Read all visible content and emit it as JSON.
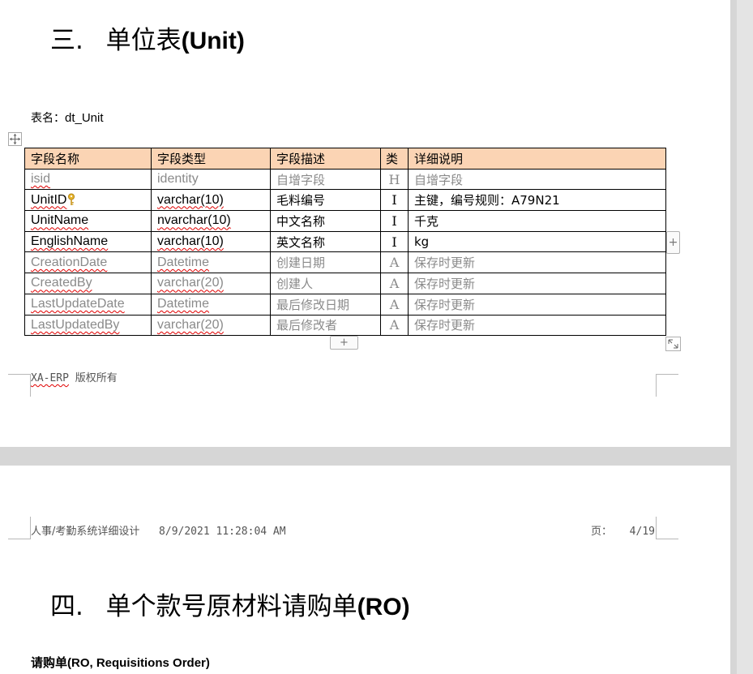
{
  "section3": {
    "number": "三.",
    "title_cn": "单位表",
    "title_en": "(Unit)",
    "table_name_label": "表名：",
    "table_name": "dt_Unit",
    "columns": [
      "字段名称",
      "字段类型",
      "字段描述",
      "类",
      "详细说明"
    ],
    "rows": [
      {
        "name": "isid",
        "type": "identity",
        "desc": "自增字段",
        "cat": "H",
        "detail": "自增字段",
        "muted": true
      },
      {
        "name": "UnitID",
        "type": "varchar(10)",
        "desc": "毛料编号",
        "cat": "I",
        "detail": "主键，编号规则：A79N21",
        "muted": false,
        "key": true
      },
      {
        "name": "UnitName",
        "type": "nvarchar(10)",
        "desc": "中文名称",
        "cat": "I",
        "detail": "千克",
        "muted": false
      },
      {
        "name": "EnglishName",
        "type": "varchar(10)",
        "desc": "英文名称",
        "cat": "I",
        "detail": "kg",
        "muted": false
      },
      {
        "name": "CreationDate",
        "type": "Datetime",
        "desc": "创建日期",
        "cat": "A",
        "detail": "保存时更新",
        "muted": true
      },
      {
        "name": "CreatedBy",
        "type": "varchar(20)",
        "desc": "创建人",
        "cat": "A",
        "detail": "保存时更新",
        "muted": true
      },
      {
        "name": "LastUpdateDate",
        "type": "Datetime",
        "desc": "最后修改日期",
        "cat": "A",
        "detail": "保存时更新",
        "muted": true
      },
      {
        "name": "LastUpdatedBy",
        "type": "varchar(20)",
        "desc": "最后修改者",
        "cat": "A",
        "detail": "保存时更新",
        "muted": true
      }
    ],
    "add_column_label": "+",
    "add_row_label": "+"
  },
  "page1_footer": {
    "brand": "XA-ERP",
    "copyright": "版权所有"
  },
  "page2_header": {
    "doc_title": "人事/考勤系统详细设计",
    "datetime": "8/9/2021 11:28:04 AM",
    "page_label": "页：",
    "page_value": "4/19"
  },
  "section4": {
    "number": "四.",
    "title_cn": "单个款号原材料请购单",
    "title_en": "(RO)",
    "subtitle_cn": "请购单",
    "subtitle_en": "(RO, Requisitions Order)"
  }
}
